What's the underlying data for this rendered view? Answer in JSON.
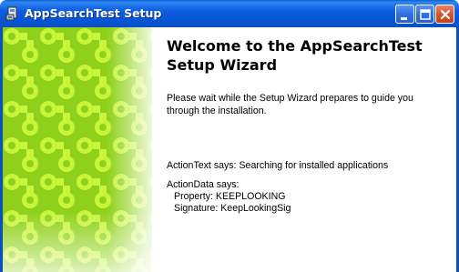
{
  "window": {
    "title": "AppSearchTest Setup",
    "icon": "installer-icon",
    "controls": {
      "minimize": "minimize-icon",
      "maximize": "maximize-icon",
      "close": "close-icon"
    }
  },
  "wizard": {
    "heading_line1": "Welcome to the AppSearchTest",
    "heading_line2": "Setup Wizard",
    "body_line1": "Please wait while the Setup Wizard prepares to guide you",
    "body_line2": "through the installation.",
    "action_text": "ActionText says: Searching for installed applications",
    "action_data_label": "ActionData says:",
    "action_data_property": "Property: KEEPLOOKING",
    "action_data_signature": "Signature: KeepLookingSig"
  },
  "colors": {
    "titlebar": "#0a5fd8",
    "art_dark": "#8fd11a",
    "art_light": "#c8f53a"
  }
}
